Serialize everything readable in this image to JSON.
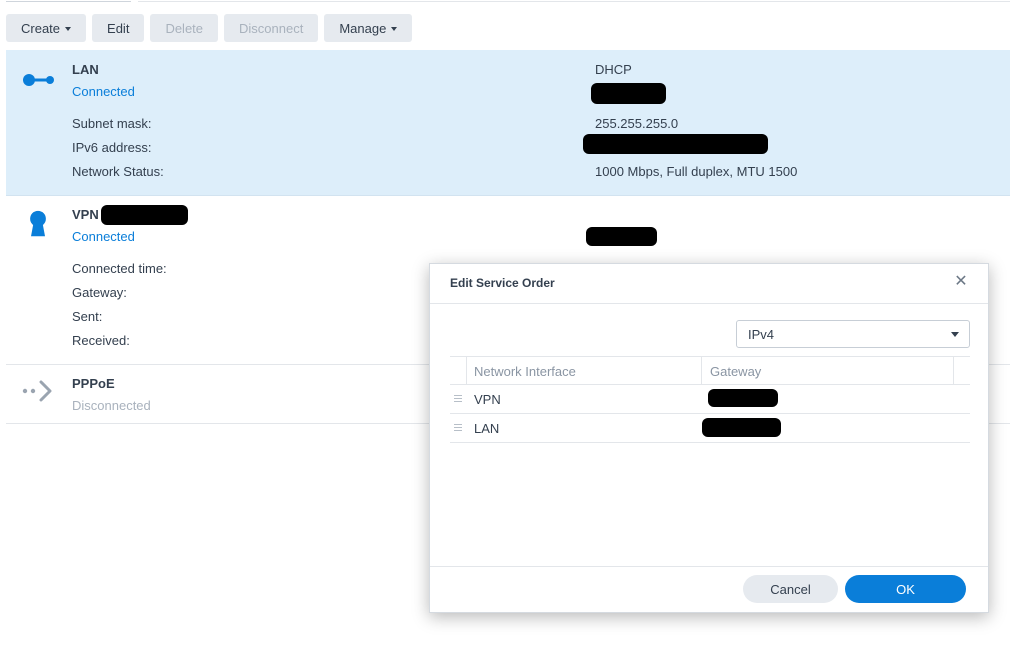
{
  "toolbar": {
    "create": "Create",
    "edit": "Edit",
    "delete": "Delete",
    "disconnect": "Disconnect",
    "manage": "Manage"
  },
  "interfaces": {
    "lan": {
      "name": "LAN",
      "status": "Connected",
      "mode": "DHCP",
      "subnet_label": "Subnet mask:",
      "subnet_value": "255.255.255.0",
      "ipv6_label": "IPv6 address:",
      "netstatus_label": "Network Status:",
      "netstatus_value": "1000 Mbps, Full duplex, MTU 1500",
      "icon": "lan-cable-icon"
    },
    "vpn": {
      "name": "VPN",
      "status": "Connected",
      "connected_time_label": "Connected time:",
      "gateway_label": "Gateway:",
      "sent_label": "Sent:",
      "received_label": "Received:",
      "icon": "keyhole-icon"
    },
    "pppoe": {
      "name": "PPPoE",
      "status": "Disconnected",
      "icon": "pppoe-arrow-icon"
    }
  },
  "dialog": {
    "title": "Edit Service Order",
    "protocol": "IPv4",
    "columns": [
      "Network Interface",
      "Gateway"
    ],
    "rows": [
      {
        "name": "VPN"
      },
      {
        "name": "LAN"
      }
    ],
    "cancel": "Cancel",
    "ok": "OK"
  },
  "colors": {
    "accent": "#0a7ed9",
    "selected_row": "#ddeefa",
    "button_gray": "#e6eaef"
  }
}
